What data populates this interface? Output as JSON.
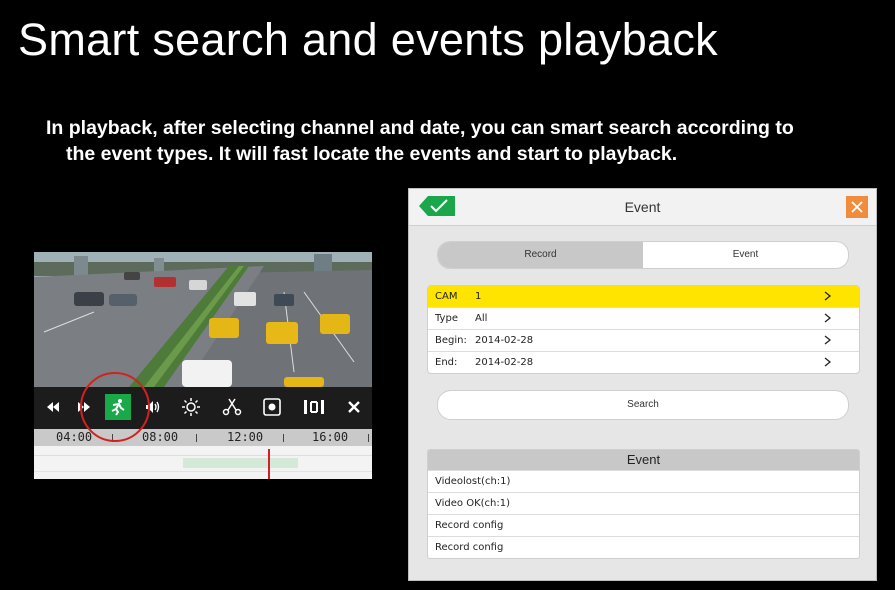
{
  "heading": {
    "title": "Smart search and events playback",
    "line1": "In playback, after selecting channel and date, you can smart search according to",
    "line2": "the event types. It will fast locate the events and start to playback."
  },
  "playback": {
    "controls": [
      {
        "name": "rewind-icon"
      },
      {
        "name": "forward-icon"
      },
      {
        "name": "smart-search-icon",
        "active": true
      },
      {
        "name": "volume-icon"
      },
      {
        "name": "brightness-icon"
      },
      {
        "name": "clip-scissors-icon"
      },
      {
        "name": "snapshot-icon"
      },
      {
        "name": "zoom-icon"
      },
      {
        "name": "close-icon"
      }
    ],
    "timeline": [
      "04:00",
      "08:00",
      "12:00",
      "16:00"
    ]
  },
  "dialog": {
    "title": "Event",
    "tabs": [
      {
        "label": "Record",
        "selected": true
      },
      {
        "label": "Event",
        "selected": false
      }
    ],
    "fields": [
      {
        "label": "CAM",
        "value": "1",
        "highlighted": true
      },
      {
        "label": "Type",
        "value": "All",
        "highlighted": false
      },
      {
        "label": "Begin:",
        "value": "2014-02-28",
        "highlighted": false
      },
      {
        "label": "End:",
        "value": "2014-02-28",
        "highlighted": false
      }
    ],
    "search_label": "Search",
    "event_list": {
      "header": "Event",
      "items": [
        "Videolost(ch:1)",
        "Video OK(ch:1)",
        "Record config",
        "Record config"
      ]
    },
    "colors": {
      "highlight": "#ffe400",
      "ok": "#1aa64a",
      "close": "#f08c3c"
    }
  }
}
